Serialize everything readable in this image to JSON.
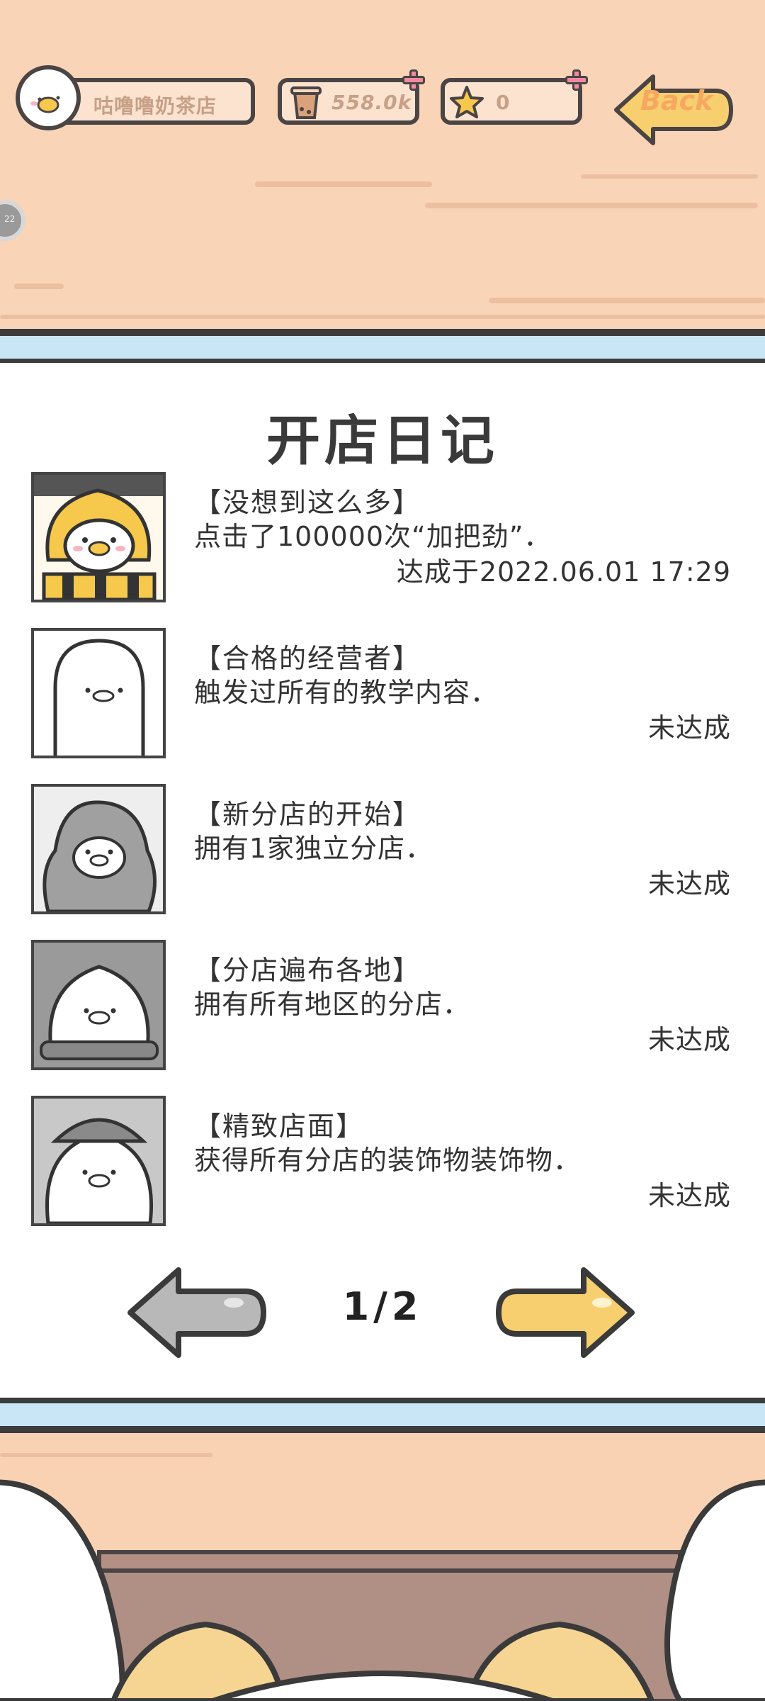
{
  "hud": {
    "shop_name": "咕噜噜奶茶店",
    "coins": "558.0k",
    "stars": "0",
    "back_label": "Back"
  },
  "side_button_label": "22",
  "diary": {
    "title": "开店日记",
    "entries": [
      {
        "title": "【没想到这么多】",
        "desc": "点击了100000次“加把劲”．",
        "status": "达成于2022.06.01 17:29",
        "achieved": true
      },
      {
        "title": "【合格的经营者】",
        "desc": "触发过所有的教学内容．",
        "status": "未达成",
        "achieved": false
      },
      {
        "title": "【新分店的开始】",
        "desc": "拥有1家独立分店．",
        "status": "未达成",
        "achieved": false
      },
      {
        "title": "【分店遍布各地】",
        "desc": "拥有所有地区的分店．",
        "status": "未达成",
        "achieved": false
      },
      {
        "title": "【精致店面】",
        "desc": "获得所有分店的装饰物装饰物．",
        "status": "未达成",
        "achieved": false
      }
    ]
  },
  "pagination": {
    "label": "1/2",
    "current": 1,
    "total": 2
  },
  "colors": {
    "wood": "#fad4b7",
    "band": "#c9e6f7",
    "outline": "#3c3c3c",
    "accent_yellow": "#f8cf6e",
    "disabled_gray": "#b8b8b8"
  }
}
